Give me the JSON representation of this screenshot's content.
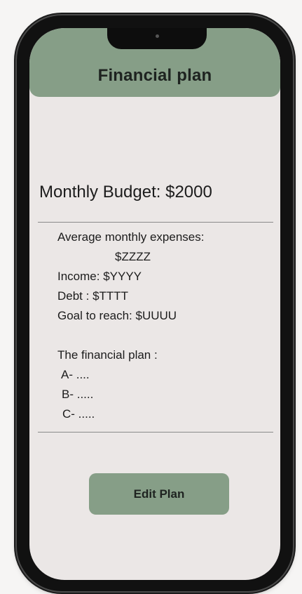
{
  "header": {
    "title": "Financial plan"
  },
  "budget": {
    "label": "Monthly Budget: $2000"
  },
  "details": {
    "expenses_label": "Average monthly expenses:",
    "expenses_value": "$ZZZZ",
    "income": "Income: $YYYY",
    "debt": "Debt : $TTTT",
    "goal": "Goal to reach: $UUUU",
    "plan_heading": "The financial plan :",
    "plan_items": [
      "A- ....",
      "B- .....",
      "C- ....."
    ]
  },
  "actions": {
    "edit_label": "Edit Plan"
  },
  "colors": {
    "accent": "#869e87",
    "screen_bg": "#ebe7e6",
    "frame": "#111111"
  }
}
